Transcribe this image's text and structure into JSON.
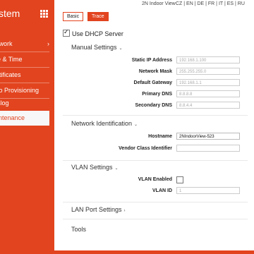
{
  "sidebar": {
    "title": "stem",
    "items": [
      {
        "label": "twork",
        "chevron": "›"
      },
      {
        "label": "e & Time"
      },
      {
        "label": "rtificates"
      },
      {
        "label": "to Provisioning"
      },
      {
        "label": "slog"
      },
      {
        "label": "intenance",
        "active": true
      }
    ]
  },
  "tabs": [
    {
      "label": "Basic"
    },
    {
      "label": "Trace"
    }
  ],
  "header": {
    "device_name": "2N Indoor View",
    "languages": "CZ | EN | DE | FR | IT | ES | RU"
  },
  "dhcp": {
    "label": "Use DHCP Server",
    "checked": true
  },
  "manual": {
    "title": "Manual Settings",
    "chevron": "⌄",
    "fields": [
      {
        "label": "Static IP Address",
        "placeholder": "192.168.1.100"
      },
      {
        "label": "Network Mask",
        "placeholder": "255.255.255.0"
      },
      {
        "label": "Default Gateway",
        "placeholder": "192.168.1.1"
      },
      {
        "label": "Primary DNS",
        "placeholder": "8.8.8.8"
      },
      {
        "label": "Secondary DNS",
        "placeholder": "8.8.4.4"
      }
    ]
  },
  "netid": {
    "title": "Network Identification",
    "chevron": "⌄",
    "hostname_label": "Hostname",
    "hostname_value": "2NIndoorView-523",
    "vendor_label": "Vendor Class Identifier",
    "vendor_value": ""
  },
  "vlan": {
    "title": "VLAN Settings",
    "chevron": "⌄",
    "enabled_label": "VLAN Enabled",
    "enabled": false,
    "id_label": "VLAN ID",
    "id_placeholder": "1"
  },
  "lanport": {
    "title": "LAN Port Settings",
    "chevron": "›"
  },
  "tools": {
    "title": "Tools"
  },
  "colors": {
    "accent": "#e2441f"
  }
}
